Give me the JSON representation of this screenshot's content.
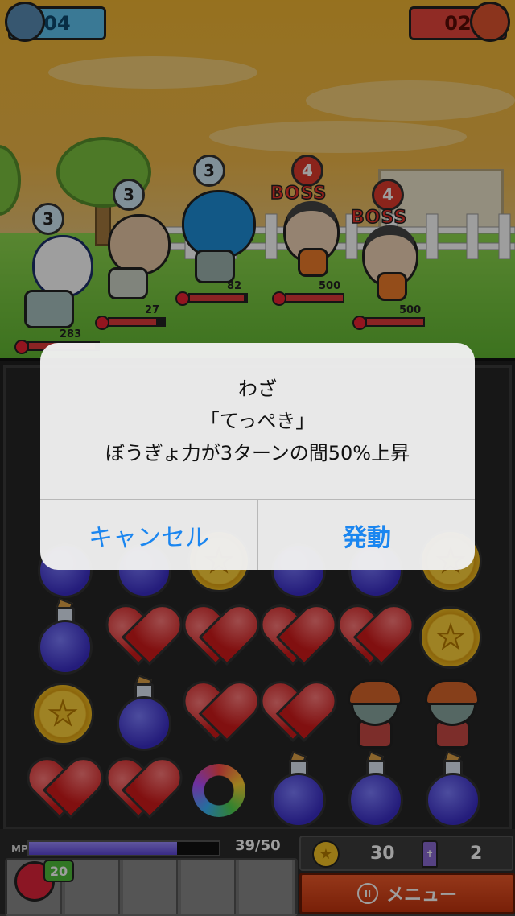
{
  "scores": {
    "left": "04",
    "right": "02"
  },
  "colors": {
    "accent_ios": "#1b86f0",
    "menu": "#e04a1c",
    "mp": "#6a55e0",
    "hp": "#e03a3a"
  },
  "party": [
    {
      "name": "",
      "level": "3",
      "hp": "283",
      "hp_fraction": 0.95,
      "boss": false
    },
    {
      "name": "",
      "level": "3",
      "hp": "27",
      "hp_fraction": 0.85,
      "boss": false
    },
    {
      "name": "",
      "level": "3",
      "hp": "82",
      "hp_fraction": 0.95,
      "boss": false
    }
  ],
  "enemies": [
    {
      "level": "4",
      "tag": "BOSS",
      "hp": "500",
      "hp_fraction": 1.0
    },
    {
      "level": "4",
      "tag": "BOSS",
      "hp": "500",
      "hp_fraction": 1.0
    }
  ],
  "board_rows": [
    [
      "potion",
      "heart",
      "heart",
      "heart",
      "heart",
      "coin"
    ],
    [
      "coin",
      "potion",
      "heart",
      "heart",
      "zombie",
      "zombie"
    ],
    [
      "heart",
      "heart",
      "swap",
      "potion",
      "potion",
      "potion"
    ]
  ],
  "hud": {
    "mp_label": "MP",
    "mp_value": "39/50",
    "mp_fraction": 0.78,
    "heal_badge": "20",
    "coins": "30",
    "coffins": "2",
    "menu_label": "メニュー"
  },
  "dialog": {
    "title": "わざ",
    "skill_name": "「てっぺき」",
    "description": "ぼうぎょ力が3ターンの間50%上昇",
    "cancel_label": "キャンセル",
    "confirm_label": "発動"
  }
}
